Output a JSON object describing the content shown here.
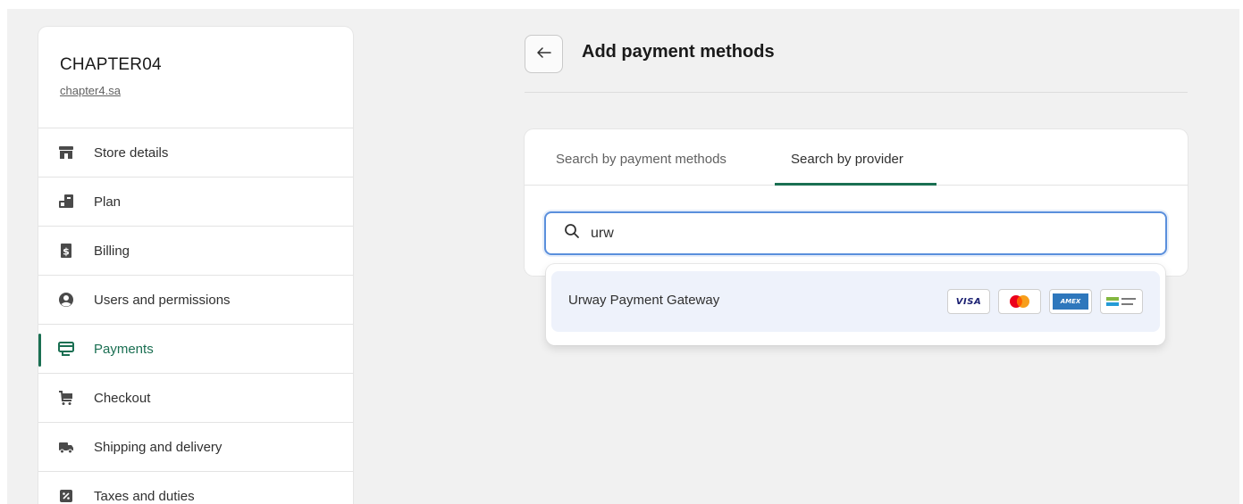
{
  "store": {
    "name": "CHAPTER04",
    "domain": "chapter4.sa"
  },
  "sidebar": {
    "items": [
      {
        "label": "Store details",
        "icon": "store-icon",
        "active": false
      },
      {
        "label": "Plan",
        "icon": "plan-icon",
        "active": false
      },
      {
        "label": "Billing",
        "icon": "billing-icon",
        "active": false
      },
      {
        "label": "Users and permissions",
        "icon": "user-icon",
        "active": false
      },
      {
        "label": "Payments",
        "icon": "payments-icon",
        "active": true
      },
      {
        "label": "Checkout",
        "icon": "cart-icon",
        "active": false
      },
      {
        "label": "Shipping and delivery",
        "icon": "truck-icon",
        "active": false
      },
      {
        "label": "Taxes and duties",
        "icon": "percent-icon",
        "active": false
      }
    ]
  },
  "page": {
    "title": "Add payment methods",
    "back_icon": "arrow-left-icon"
  },
  "tabs": {
    "by_methods": "Search by payment methods",
    "by_provider": "Search by provider",
    "active": "by_provider"
  },
  "search": {
    "value": "urw",
    "icon": "search-icon"
  },
  "results": [
    {
      "label": "Urway Payment Gateway",
      "methods": [
        "visa-icon",
        "mastercard-icon",
        "amex-icon",
        "mada-icon"
      ]
    }
  ],
  "colors": {
    "accent": "#1a6f52",
    "focus": "#5a8fdc",
    "result_highlight": "#eef2fb"
  },
  "badges": {
    "visa": "VISA",
    "amex": "AMEX"
  }
}
